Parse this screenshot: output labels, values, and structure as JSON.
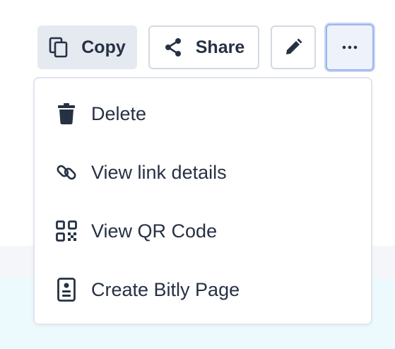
{
  "toolbar": {
    "copy_label": "Copy",
    "share_label": "Share",
    "edit_icon": "pencil-icon",
    "more_icon": "ellipsis-icon"
  },
  "menu": {
    "items": [
      {
        "label": "Delete",
        "icon": "trash-icon"
      },
      {
        "label": "View link details",
        "icon": "link-icon"
      },
      {
        "label": "View QR Code",
        "icon": "qr-code-icon"
      },
      {
        "label": "Create Bitly Page",
        "icon": "page-icon"
      }
    ]
  },
  "colors": {
    "text": "#273144",
    "copy_button_bg": "#e5e9f0",
    "more_button_focus": "#9fb4ec",
    "band_light_gray": "#f4f6fa",
    "band_light_cyan": "#ecfafd"
  }
}
